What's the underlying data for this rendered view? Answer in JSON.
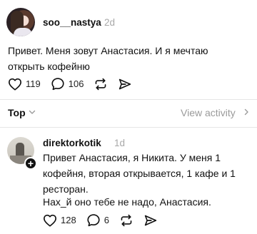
{
  "post": {
    "username": "soo__nastya",
    "time": "2d",
    "text": "Привет. Меня зовут Анастасия. И я мечтаю открыть кофейню",
    "likes": "119",
    "comments": "106"
  },
  "sort": {
    "label": "Top",
    "view_activity": "View activity"
  },
  "reply": {
    "username": "direktorkotik",
    "time": "1d",
    "text": "Привет Анастасия, я Никита. У меня 1 кофейня, вторая открывается, 1 кафе и 1 ресторан.",
    "text2": "Нах_й оно тебе не надо, Анастасия.",
    "likes": "128",
    "comments": "6"
  },
  "icons": {
    "like": "heart-icon",
    "comment": "comment-icon",
    "repost": "repost-icon",
    "share": "share-icon",
    "add": "plus-icon"
  }
}
